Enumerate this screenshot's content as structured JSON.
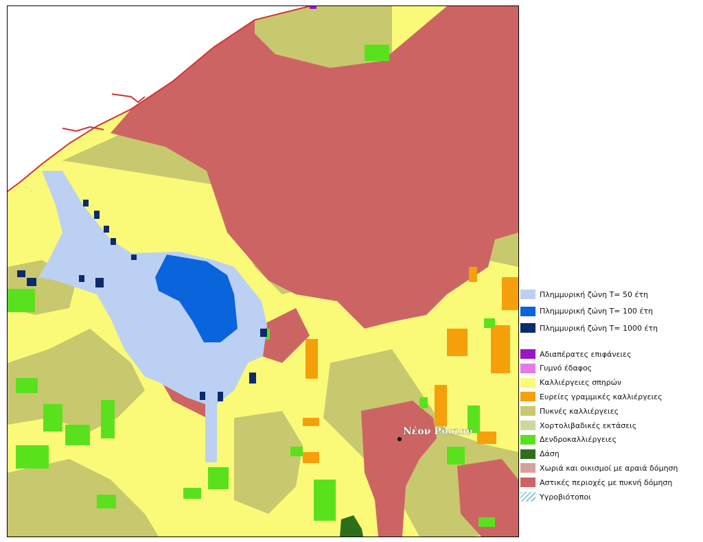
{
  "colors": {
    "flood_50": "#bcd0f3",
    "flood_100": "#0a64dc",
    "flood_1000": "#0c2a6e",
    "impermeable": "#9a14c8",
    "bare_soil": "#e47ae8",
    "arable": "#fafa78",
    "broad_linear": "#f5a00a",
    "dense_crops": "#c8c86e",
    "pasture": "#cfd6a0",
    "orchards": "#5ae11e",
    "forest": "#2e6e1a",
    "villages_sparse": "#d8a09a",
    "urban_dense": "#cd6464",
    "wetlands": "#8cc8e6",
    "sea": "#ffffff",
    "coastline": "#d23232"
  },
  "map": {
    "place_label": "Νέον Ρύσιον",
    "place_marker": "settlement-dot"
  },
  "legend": {
    "flood_zones": [
      {
        "key": "flood_50",
        "label": "Πλημμυρική ζώνη Τ= 50 έτη"
      },
      {
        "key": "flood_100",
        "label": "Πλημμυρική ζώνη Τ= 100 έτη"
      },
      {
        "key": "flood_1000",
        "label": "Πλημμυρική ζώνη Τ= 1000 έτη"
      }
    ],
    "land_cover": [
      {
        "key": "impermeable",
        "label": "Αδιαπέρατες επιφάνειες"
      },
      {
        "key": "bare_soil",
        "label": "Γυμνό έδαφος"
      },
      {
        "key": "arable",
        "label": "Καλλιέργειες σπηρών"
      },
      {
        "key": "broad_linear",
        "label": "Ευρείες γραμμικές καλλιέργειες"
      },
      {
        "key": "dense_crops",
        "label": "Πυκνές καλλιέργειες"
      },
      {
        "key": "pasture",
        "label": "Χορτολιβαδικές εκτάσεις"
      },
      {
        "key": "orchards",
        "label": "Δενδροκαλλιέργειες"
      },
      {
        "key": "forest",
        "label": "Δάση"
      },
      {
        "key": "villages_sparse",
        "label": "Χωριά και οικισμοί με αραιά δόμηση"
      },
      {
        "key": "urban_dense",
        "label": "Αστικές περιοχές με πυκνή δόμηση"
      },
      {
        "key": "wetlands",
        "label": "Υγροβιότοποι"
      }
    ]
  }
}
